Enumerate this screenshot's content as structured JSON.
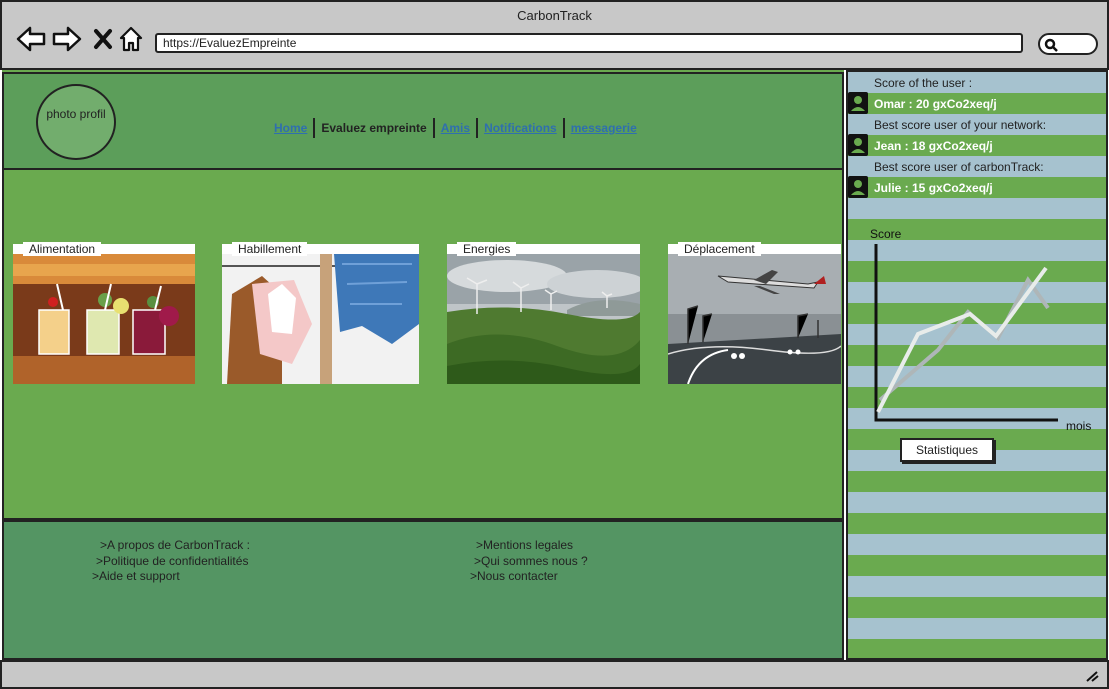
{
  "window": {
    "title": "CarbonTrack"
  },
  "browser": {
    "url": "https://EvaluezEmpreinte"
  },
  "header": {
    "photo_label": "photo profil",
    "nav": [
      {
        "label": "Home",
        "current": false
      },
      {
        "label": "Evaluez empreinte",
        "current": true
      },
      {
        "label": "Amis",
        "current": false
      },
      {
        "label": "Notifications",
        "current": false
      },
      {
        "label": "messagerie",
        "current": false
      }
    ]
  },
  "categories": [
    {
      "label": "Alimentation",
      "icon": "cocktails-image"
    },
    {
      "label": "Habillement",
      "icon": "clothes-image"
    },
    {
      "label": "Energies",
      "icon": "wind-turbines-image"
    },
    {
      "label": "Déplacement",
      "icon": "airplane-road-image"
    }
  ],
  "footer": {
    "left": [
      ">A propos de CarbonTrack :",
      ">Politique de confidentialités",
      ">Aide et support"
    ],
    "right": [
      ">Mentions legales",
      ">Qui sommes nous ?",
      ">Nous contacter"
    ]
  },
  "sidebar": {
    "user_label": "Score of the user :",
    "user_score": "Omar : 20 gxCo2xeq/j",
    "network_label": "Best score  user of your network:",
    "network_score": "Jean : 18 gxCo2xeq/j",
    "global_label": "Best score  user of carbonTrack:",
    "global_score": "Julie : 15 gxCo2xeq/j",
    "chart_ylabel": "Score",
    "chart_xlabel": "mois",
    "stats_button": "Statistiques"
  },
  "colors": {
    "main_green": "#6aaa4f",
    "header_green": "#5c9e5a",
    "footer_green": "#549563",
    "stripe_blue": "#a6c2cf",
    "link_blue": "#2f6fae"
  }
}
